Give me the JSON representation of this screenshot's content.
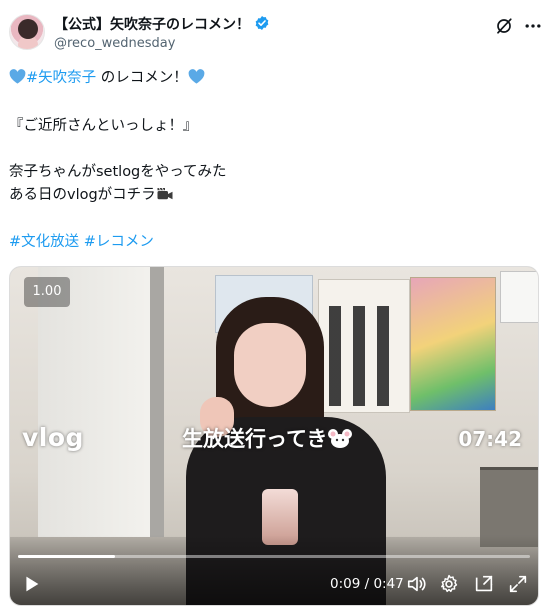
{
  "account": {
    "name": "【公式】矢吹奈子のレコメン！",
    "handle": "@reco_wednesday"
  },
  "tweet": {
    "line1_hashtag": "#矢吹奈子",
    "line1_text": " のレコメン！",
    "line2": "『ご近所さんといっしょ！』",
    "line3": "奈子ちゃんがsetlogをやってみた",
    "line4": "ある日のvlogがコチラ",
    "hashtag_a": "#文化放送",
    "hashtag_b": "#レコメン"
  },
  "video": {
    "playback_speed": "1.00",
    "overlay_label": "vlog",
    "overlay_caption": "生放送行ってき",
    "overlay_duration": "07:42",
    "time_readout": "0:09 / 0:47",
    "progress_fraction": 0.19
  },
  "icons": [
    "verified-badge-icon",
    "x-logo-icon",
    "more-options-icon",
    "blue-heart-icon",
    "video-camera-icon",
    "mouse-icon",
    "play-icon",
    "volume-icon",
    "settings-gear-icon",
    "picture-in-picture-icon",
    "fullscreen-icon"
  ],
  "colors": {
    "link": "#1d9bf0",
    "verified": "#1d9bf0",
    "text": "#0f1419",
    "muted": "#536471"
  }
}
